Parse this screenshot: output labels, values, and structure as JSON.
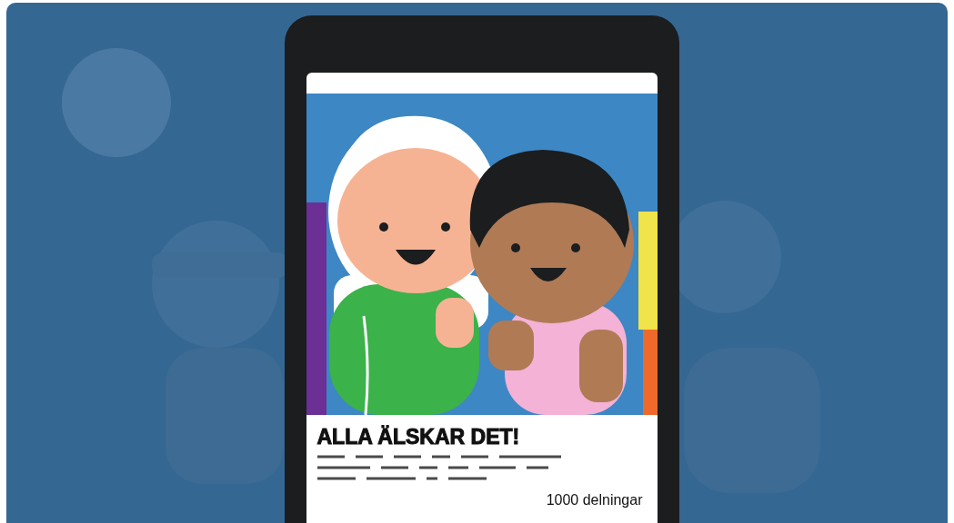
{
  "post": {
    "headline": "ALLA ÄLSKAR DET!",
    "shares": "1000 delningar"
  }
}
